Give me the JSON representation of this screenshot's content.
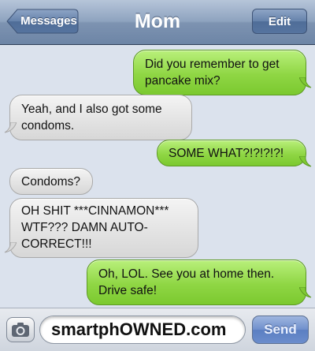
{
  "header": {
    "back_label": "Messages",
    "title": "Mom",
    "edit_label": "Edit"
  },
  "messages": [
    {
      "side": "out",
      "text": "Did you remember to get pancake mix?"
    },
    {
      "side": "in",
      "text": "Yeah, and I also got some condoms."
    },
    {
      "side": "out",
      "text": "SOME WHAT?!?!?!?!"
    },
    {
      "side": "in",
      "text": "Condoms?"
    },
    {
      "side": "in",
      "text": "OH SHIT ***CINNAMON*** WTF??? DAMN AUTO-CORRECT!!!"
    },
    {
      "side": "out",
      "text": "Oh, LOL. See you at home then. Drive safe!"
    }
  ],
  "input_bar": {
    "camera_icon": "camera-icon",
    "field_text": "smartphOWNED.com",
    "send_label": "Send"
  },
  "colors": {
    "outgoing_bubble": "#8fd644",
    "incoming_bubble": "#e2e2e2",
    "navbar": "#7d93b1",
    "background": "#dbe2ed"
  }
}
